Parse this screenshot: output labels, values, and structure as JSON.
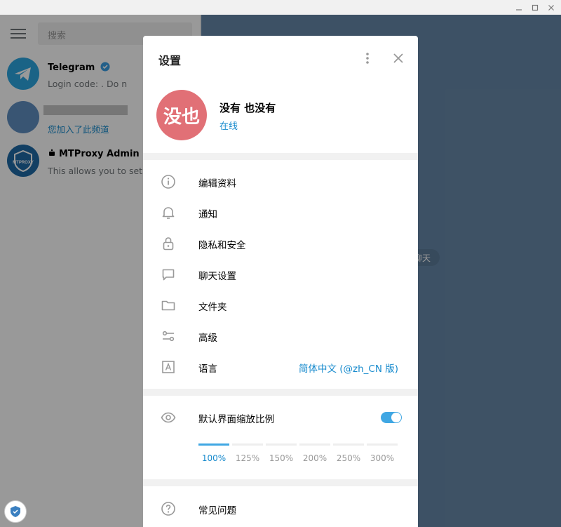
{
  "window": {
    "controls": [
      "minimize-icon",
      "maximize-icon",
      "close-icon"
    ]
  },
  "sidebar": {
    "search_placeholder": "搜索",
    "chats": [
      {
        "name": "Telegram",
        "message": "Login code:        . Do n",
        "avatar_color": "#2ca5e0",
        "verified": true
      },
      {
        "name": "",
        "message": "您加入了此频道",
        "avatar_color": "#5f8ec0"
      },
      {
        "name": "MTProxy Admin Bo",
        "message": "This allows you to set u",
        "avatar_color": "#1e6aa6"
      }
    ]
  },
  "background_pill": "聊天",
  "settings": {
    "title": "设置",
    "profile": {
      "initials": "没也",
      "name": "没有 也没有",
      "status": "在线",
      "avatar_color": "#e17076"
    },
    "menu": [
      {
        "icon": "info-icon",
        "label": "编辑资料"
      },
      {
        "icon": "bell-icon",
        "label": "通知"
      },
      {
        "icon": "lock-icon",
        "label": "隐私和安全"
      },
      {
        "icon": "chat-bubble-icon",
        "label": "聊天设置"
      },
      {
        "icon": "folder-icon",
        "label": "文件夹"
      },
      {
        "icon": "sliders-icon",
        "label": "高级"
      },
      {
        "icon": "language-icon",
        "label": "语言",
        "value": "简体中文 (@zh_CN 版)"
      }
    ],
    "scale": {
      "label": "默认界面缩放比例",
      "enabled": true,
      "options": [
        "100%",
        "125%",
        "150%",
        "200%",
        "250%",
        "300%"
      ],
      "selected": "100%"
    },
    "faq": "常见问题"
  },
  "colors": {
    "accent": "#168acd",
    "toggle": "#40a7e3",
    "chat_background": "#6788a9"
  }
}
